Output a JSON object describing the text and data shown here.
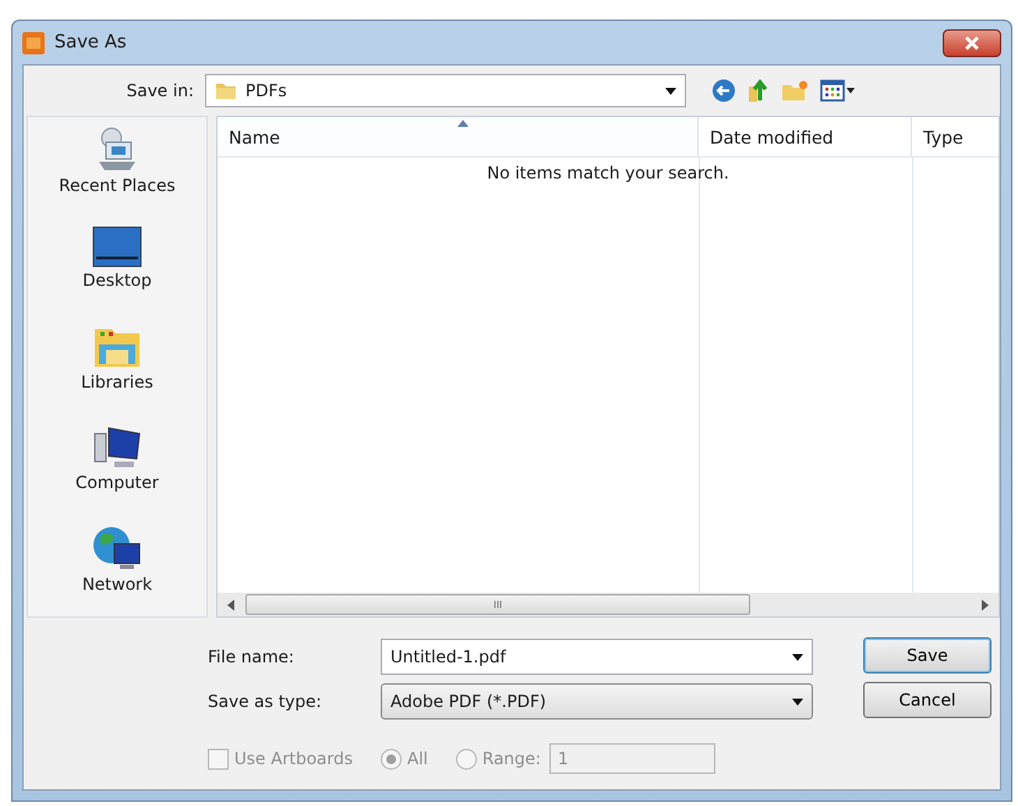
{
  "window": {
    "title": "Save As"
  },
  "save_in": {
    "label": "Save in:",
    "value": "PDFs"
  },
  "sidebar": {
    "items": [
      {
        "label": "Recent Places",
        "kind": "recent"
      },
      {
        "label": "Desktop",
        "kind": "desktop"
      },
      {
        "label": "Libraries",
        "kind": "libraries"
      },
      {
        "label": "Computer",
        "kind": "computer"
      },
      {
        "label": "Network",
        "kind": "network"
      }
    ]
  },
  "table": {
    "columns": [
      {
        "label": "Name",
        "sorted": true
      },
      {
        "label": "Date modified",
        "sorted": false
      },
      {
        "label": "Type",
        "sorted": false
      }
    ],
    "empty_message": "No items match your search."
  },
  "scrollbar": {
    "grip": "III"
  },
  "file_name": {
    "label": "File name:",
    "value": "Untitled-1.pdf"
  },
  "save_as_type": {
    "label": "Save as type:",
    "value": "Adobe PDF (*.PDF)"
  },
  "buttons": [
    {
      "label": "Save",
      "default": true
    },
    {
      "label": "Cancel",
      "default": false
    }
  ],
  "options": {
    "use_artboards": {
      "label": "Use Artboards",
      "checked": false,
      "disabled": true
    },
    "radios": [
      {
        "label": "All",
        "selected": true,
        "disabled": true
      },
      {
        "label": "Range:",
        "selected": false,
        "disabled": true
      }
    ],
    "range_value": "1"
  }
}
